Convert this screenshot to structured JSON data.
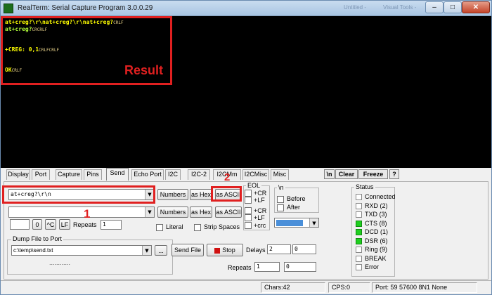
{
  "window": {
    "title": "RealTerm: Serial Capture Program 3.0.0.29",
    "ghost_left": "Untitled -",
    "ghost_right": "Visual Tools -",
    "min_label": "–",
    "max_label": "□",
    "close_label": "✕"
  },
  "terminal": {
    "line1_cmd": "at+creg?\\r\\nat+creg?\\r\\nat+creg?",
    "line1_ctl": "CRLF",
    "line2_cmd": "at+creg?",
    "line2_ctl": "CRCRLF",
    "line3_text": "+CREG: 0,1",
    "line3_ctl": "CRLFCRLF",
    "line4_text": "OK",
    "line4_ctl": "CRLF"
  },
  "annotations": {
    "result": "Result",
    "one": "1",
    "two": "2"
  },
  "tabs": [
    "Display",
    "Port",
    "Capture",
    "Pins",
    "Send",
    "Echo Port",
    "I2C",
    "I2C-2",
    "I2CMisc",
    "I2CMisc",
    "Misc"
  ],
  "tab_labels": {
    "display": "Display",
    "port": "Port",
    "capture": "Capture",
    "pins": "Pins",
    "send": "Send",
    "echo": "Echo Port",
    "i2c": "I2C",
    "i2c2": "I2C-2",
    "i2cm": "I2CMm",
    "i2cmisc": "I2CMisc",
    "misc": "Misc"
  },
  "panel_buttons": {
    "newline": "\\n",
    "clear": "Clear",
    "freeze": "Freeze",
    "help": "?"
  },
  "send": {
    "line1_value": "at+creg?\\r\\n",
    "line2_value": "",
    "numbers1": "Numbers",
    "as_hex1": "as Hex",
    "as_ascii1": "as ASCII",
    "numbers2": "Numbers",
    "as_hex2": "as Hex",
    "as_ascii2": "as ASCII",
    "small_value": "",
    "zero_btn": "0",
    "caret_c_btn": "^C",
    "lf_btn": "LF",
    "repeats_label": "Repeats",
    "repeats_value": "1",
    "literal_label": "Literal",
    "strip_spaces_label": "Strip Spaces",
    "eol_title": "EOL",
    "eol_cr1": "+CR",
    "eol_lf1": "+LF",
    "eol_cr2": "+CR",
    "eol_lf2": "+LF",
    "eol_crc": "+crc",
    "nl_title": "\\n",
    "before_label": "Before",
    "after_label": "After",
    "dump_title": "Dump File to Port",
    "dump_path": "c:\\temp\\send.txt",
    "browse_btn": "...",
    "send_file_btn": "Send File",
    "stop_btn": "Stop",
    "delays_label": "Delays",
    "delay1": "2",
    "delay2": "0",
    "repeats2_label": "Repeats",
    "repeats2_a": "1",
    "repeats2_b": "0",
    "progress_dots": "............"
  },
  "status": {
    "title": "Status",
    "items": [
      {
        "label": "Connected",
        "on": false
      },
      {
        "label": "RXD (2)",
        "on": false
      },
      {
        "label": "TXD (3)",
        "on": false
      },
      {
        "label": "CTS (8)",
        "on": true
      },
      {
        "label": "DCD (1)",
        "on": true
      },
      {
        "label": "DSR (6)",
        "on": true
      },
      {
        "label": "Ring (9)",
        "on": false
      },
      {
        "label": "BREAK",
        "on": false
      },
      {
        "label": "Error",
        "on": false
      }
    ]
  },
  "statusbar": {
    "chars": "Chars:42",
    "cps": "CPS:0",
    "port": "Port: 59  57600 8N1 None"
  },
  "colors": {
    "annotation": "#e02020",
    "terminal_bg": "#000000",
    "cmd": "#ffff00",
    "led_on": "#1fcf1f"
  }
}
